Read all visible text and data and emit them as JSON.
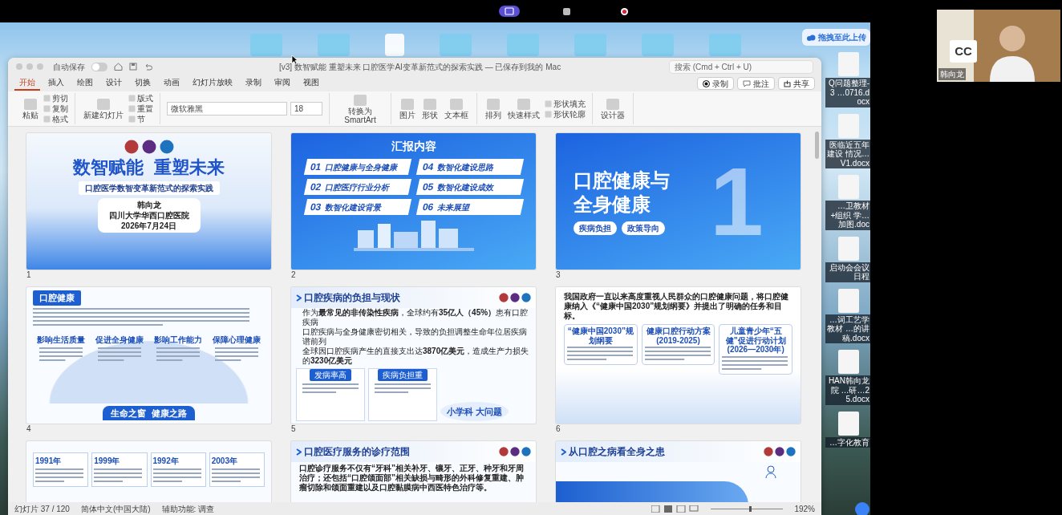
{
  "screen_share_bar": {
    "buttons": [
      {
        "kind": "share",
        "selected": true
      },
      {
        "kind": "stop",
        "selected": false
      },
      {
        "kind": "record",
        "selected": false
      }
    ]
  },
  "window": {
    "title": "[v3] 数智赋能 重塑未来 口腔医学AI变革新范式的探索实践 — 已保存到我的 Mac",
    "autosave": {
      "label": "自动保存",
      "on": false
    },
    "search": {
      "placeholder": "搜索 (Cmd + Ctrl + U)"
    }
  },
  "ribbon": {
    "tabs": [
      {
        "label": "开始",
        "selected": true
      },
      {
        "label": "插入",
        "selected": false
      },
      {
        "label": "绘图",
        "selected": false
      },
      {
        "label": "设计",
        "selected": false
      },
      {
        "label": "切换",
        "selected": false
      },
      {
        "label": "动画",
        "selected": false
      },
      {
        "label": "幻灯片放映",
        "selected": false
      },
      {
        "label": "录制",
        "selected": false
      },
      {
        "label": "审阅",
        "selected": false
      },
      {
        "label": "视图",
        "selected": false
      }
    ],
    "actions": [
      {
        "kind": "record",
        "label": "录制"
      },
      {
        "kind": "comment",
        "label": "批注"
      },
      {
        "kind": "share",
        "label": "共享"
      }
    ],
    "groups": [
      [
        {
          "kind": "big",
          "label": "粘贴"
        },
        {
          "kind": "small",
          "label": "剪切"
        },
        {
          "kind": "small",
          "label": "复制"
        },
        {
          "kind": "small",
          "label": "格式"
        }
      ],
      [
        {
          "kind": "big",
          "label": "新建幻灯片"
        },
        {
          "kind": "small",
          "label": "版式"
        },
        {
          "kind": "small",
          "label": "重置"
        },
        {
          "kind": "small",
          "label": "节"
        }
      ],
      [
        {
          "kind": "font",
          "label": "微软雅黑"
        },
        {
          "kind": "size",
          "label": "18"
        }
      ],
      [
        {
          "kind": "big",
          "label": "转换为SmartArt"
        }
      ],
      [
        {
          "kind": "big",
          "label": "图片"
        },
        {
          "kind": "big",
          "label": "形状"
        },
        {
          "kind": "big",
          "label": "文本框"
        }
      ],
      [
        {
          "kind": "big",
          "label": "排列"
        },
        {
          "kind": "big",
          "label": "快速样式"
        },
        {
          "kind": "small",
          "label": "形状填充"
        },
        {
          "kind": "small",
          "label": "形状轮廓"
        }
      ],
      [
        {
          "kind": "big",
          "label": "设计器"
        }
      ]
    ]
  },
  "slides": [
    {
      "kind": "cover",
      "number": "1",
      "title": "数智赋能  重塑未来",
      "subtitle": "口腔医学数智变革新范式的探索实践",
      "info": [
        "韩向龙",
        "四川大学华西口腔医院",
        "2026年7月24日"
      ]
    },
    {
      "kind": "agenda",
      "number": "2",
      "title": "汇报内容",
      "items": [
        {
          "no": "01",
          "label": "口腔健康与全身健康"
        },
        {
          "no": "04",
          "label": "数智化建设思路"
        },
        {
          "no": "02",
          "label": "口腔医疗行业分析"
        },
        {
          "no": "05",
          "label": "数智化建设成效"
        },
        {
          "no": "03",
          "label": "数智化建设背景"
        },
        {
          "no": "06",
          "label": "未来展望"
        }
      ]
    },
    {
      "kind": "section",
      "number": "3",
      "title": "口腔健康与全身健康",
      "big_number": "1",
      "tags": [
        "疾病负担",
        "政策导向"
      ]
    },
    {
      "kind": "health",
      "number": "4",
      "title": "口腔健康",
      "cards": [
        "影响生活质量",
        "促进全身健康",
        "影响工作能力",
        "保障心理健康"
      ],
      "footer": "生命之窗  健康之路"
    },
    {
      "kind": "burden",
      "number": "5",
      "title": "口腔疾病的负担与现状",
      "bullets": [
        "作为**最常见的非传染性疾病**，全球约有**35亿人（45%）**患有口腔疾病",
        "口腔疾病与全身健康密切相关，导致的负担调整生命年位居疾病谱前列",
        "全球因口腔疾病产生的直接支出达**3870亿美元**，造成生产力损失的**3230亿美元**"
      ],
      "panels": [
        "发病率高",
        "疾病负担重"
      ],
      "slogan": "小学科 大问题"
    },
    {
      "kind": "policy",
      "number": "6",
      "intro": "我国政府一直以来高度重视人民群众的口腔健康问题，将口腔健康纳入《“健康中国2030”规划纲要》并提出了明确的任务和目标。",
      "cards": [
        "“健康中国2030”规划纲要",
        "健康口腔行动方案 (2019-2025)",
        "儿童青少年“五健”促进行动计划 (2026—2030年)"
      ]
    },
    {
      "kind": "timeline",
      "years": [
        "1991年",
        "1999年",
        "1992年",
        "2003年"
      ]
    },
    {
      "kind": "scope",
      "title": "口腔医疗服务的诊疗范围",
      "text": "口腔诊疗服务不仅有“牙科”相关补牙、镶牙、正牙、种牙和牙周治疗；还包括“口腔颌面部”相关缺损与畸形的外科修复重建、肿瘤切除和颌面重建以及口腔黏膜病中西医特色治疗等。"
    },
    {
      "kind": "systemic",
      "title": "从口腔之病看全身之患"
    }
  ],
  "status_bar": {
    "slide": "幻灯片 37 / 120",
    "language": "简体中文(中国大陆)",
    "accessibility": "辅助功能: 调查",
    "zoom": "192%",
    "zoom_slider": {
      "level": 0.55
    }
  },
  "desktop": {
    "upload_button": "拖拽至此上传",
    "files": [
      "Q问题整理-3 …0716.docx",
      "医临近五年建设 情况…V1.docx",
      "…卫教材+组织 学…加图.doc",
      "启动会会议日程",
      "…词工艺学教材 …的讲稿.docx",
      "HAN韩向龙院 …研…25.docx",
      "…字化教育"
    ]
  },
  "webcam": {
    "logo": "CC",
    "name": "韩向龙"
  }
}
